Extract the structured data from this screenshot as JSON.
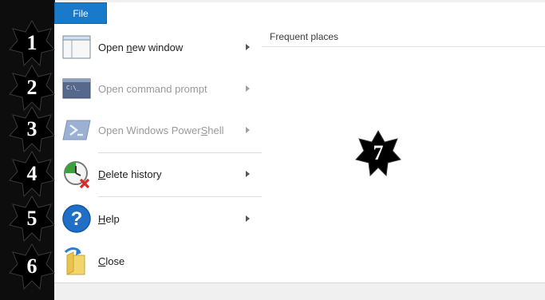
{
  "ribbon": {
    "file_tab": "File"
  },
  "menu": {
    "items": [
      {
        "label": "Open new window",
        "access_key_index": 5,
        "enabled": true,
        "icon": "window-icon"
      },
      {
        "label": "Open command prompt",
        "access_key_index": 21,
        "enabled": false,
        "icon": "command-prompt-icon"
      },
      {
        "label": "Open Windows PowerShell",
        "access_key_index": 18,
        "enabled": false,
        "icon": "powershell-icon"
      },
      {
        "label": "Delete history",
        "access_key_index": 0,
        "enabled": true,
        "icon": "delete-history-icon"
      },
      {
        "label": "Help",
        "access_key_index": 0,
        "enabled": true,
        "icon": "help-icon"
      },
      {
        "label": "Close",
        "access_key_index": 0,
        "enabled": true,
        "icon": "close-folder-icon"
      }
    ]
  },
  "places": {
    "header": "Frequent places"
  },
  "annotations": {
    "badges": [
      "1",
      "2",
      "3",
      "4",
      "5",
      "6",
      "7"
    ],
    "color": "#000000"
  },
  "colors": {
    "accent": "#1979ca",
    "background": "#0d0d0d",
    "panel": "#ffffff"
  }
}
